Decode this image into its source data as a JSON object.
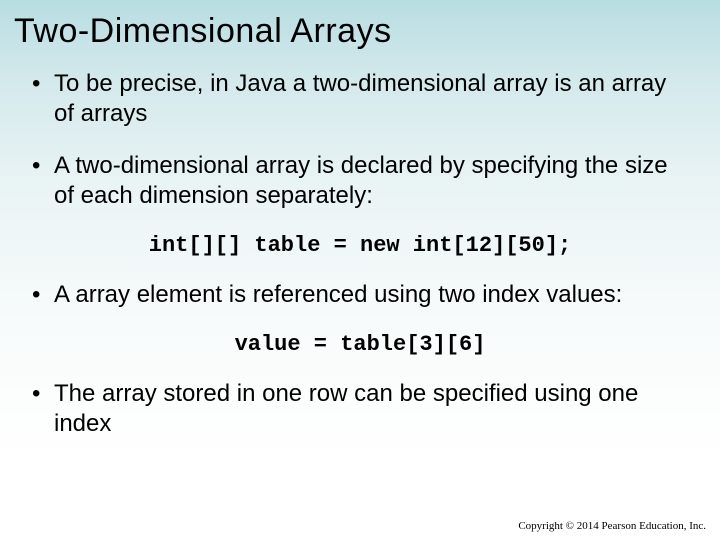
{
  "title": "Two-Dimensional Arrays",
  "bullets": {
    "b1": "To be precise, in Java a two-dimensional array is an array of arrays",
    "b2": "A two-dimensional array is declared by specifying the size of each dimension separately:",
    "b3": "A array element is referenced using two index values:",
    "b4": "The array stored in one row can be specified using one index"
  },
  "code": {
    "c1": "int[][] table = new int[12][50];",
    "c2": "value = table[3][6]"
  },
  "footer": "Copyright © 2014 Pearson Education, Inc."
}
